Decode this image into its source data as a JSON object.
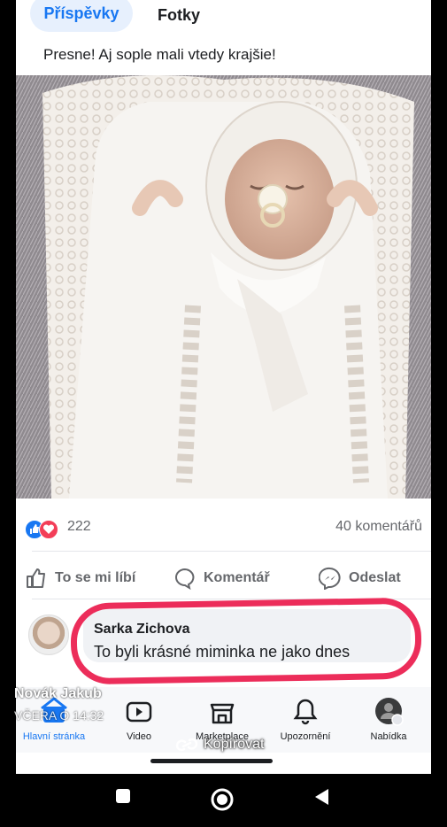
{
  "tabs": {
    "posts": "Příspěvky",
    "photos": "Fotky"
  },
  "post": {
    "text": "Presne! Aj sople mali vtedy krajšie!"
  },
  "stats": {
    "reactions": "222",
    "comments": "40 komentářů"
  },
  "actions": {
    "like": "To se mi líbí",
    "comment": "Komentář",
    "send": "Odeslat"
  },
  "comment": {
    "author": "Sarka Zichova",
    "text": "To byli krásné miminka ne jako dnes"
  },
  "overlay": {
    "name": "Novák Jakub",
    "time": "VČERA O 14:32",
    "copy": "Kopírovat"
  },
  "nav": {
    "home": "Hlavní stránka",
    "video": "Video",
    "marketplace": "Marketplace",
    "notifications": "Upozornění",
    "menu": "Nabídka"
  },
  "colors": {
    "accent": "#1877f2",
    "highlight": "#ec2d5a"
  }
}
